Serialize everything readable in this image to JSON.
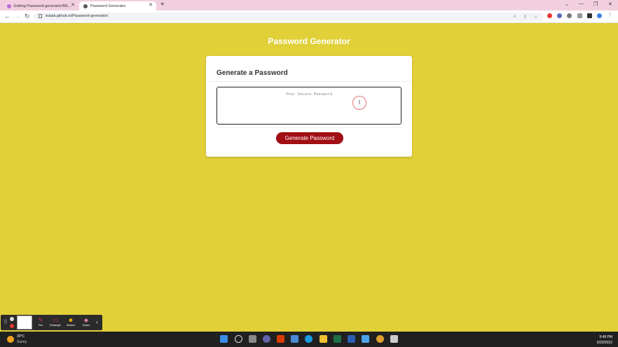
{
  "browser": {
    "tabs": [
      {
        "title": "Editing Password-generator/RE...",
        "active": false
      },
      {
        "title": "Password Generator",
        "active": true
      }
    ],
    "url": "inaiak.github.io/Password-generator/"
  },
  "app": {
    "title": "Password Generator",
    "card_title": "Generate a Password",
    "password_placeholder": "Your Secure Password",
    "generate_button": "Generate Password"
  },
  "annotation_toolbar": {
    "tools": [
      {
        "label": "Pen",
        "icon": "pen-icon"
      },
      {
        "label": "Rectangle",
        "icon": "rectangle-icon"
      },
      {
        "label": "Stickers",
        "icon": "sticker-icon"
      },
      {
        "label": "Eraser",
        "icon": "eraser-icon"
      }
    ]
  },
  "taskbar": {
    "weather_temp": "30°C",
    "weather_cond": "Sunny",
    "time": "9:48 PM",
    "date": "9/20/2022"
  },
  "colors": {
    "page_bg": "#e1d038",
    "button": "#a10e13",
    "tabbar": "#f2cfdf"
  }
}
